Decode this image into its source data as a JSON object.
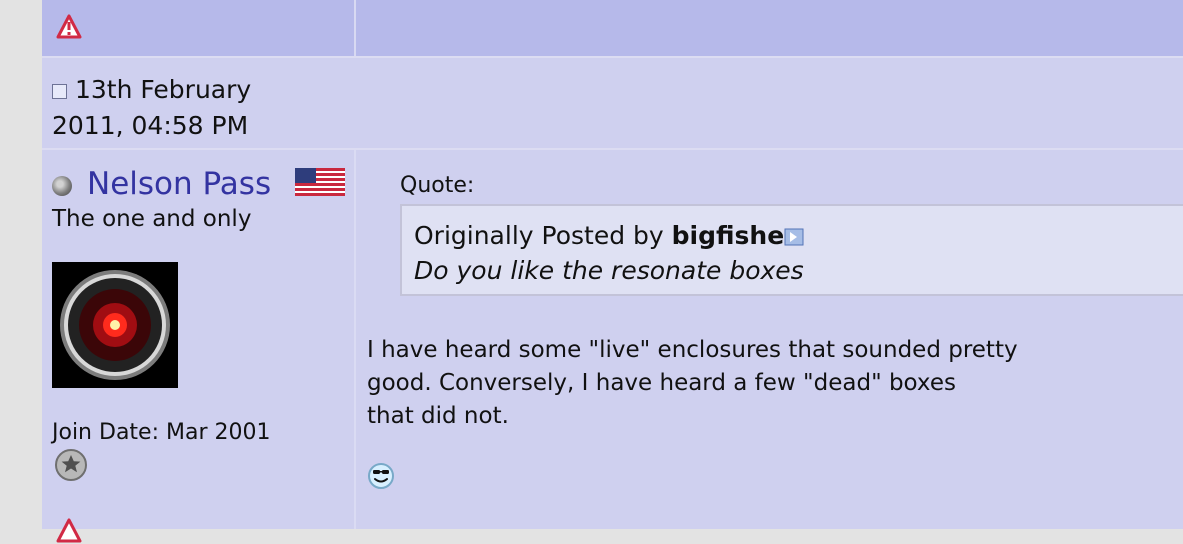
{
  "post": {
    "date": "13th February",
    "time": "2011, 04:58 PM"
  },
  "user": {
    "name": "Nelson Pass",
    "title": "The one and only",
    "join_date": "Join Date: Mar 2001",
    "avatar_icon": "hal-9000-eye-avatar",
    "flag_icon": "us-flag-icon"
  },
  "quote": {
    "label": "Quote:",
    "prefix": "Originally Posted by ",
    "author": "bigfishe",
    "text": "Do you like the resonate boxes"
  },
  "message": {
    "lines": [
      "I have heard some \"live\" enclosures that sounded pretty",
      "good. Conversely, I have heard a few \"dead\" boxes",
      "that did not."
    ],
    "smiley_icon": "cool-sunglasses-smiley-icon"
  },
  "colors": {
    "header_bar": "#b6b9ea",
    "post_bg": "#cfd0ef",
    "username": "#3333a1",
    "quote_bg": "#dfe1f3"
  }
}
